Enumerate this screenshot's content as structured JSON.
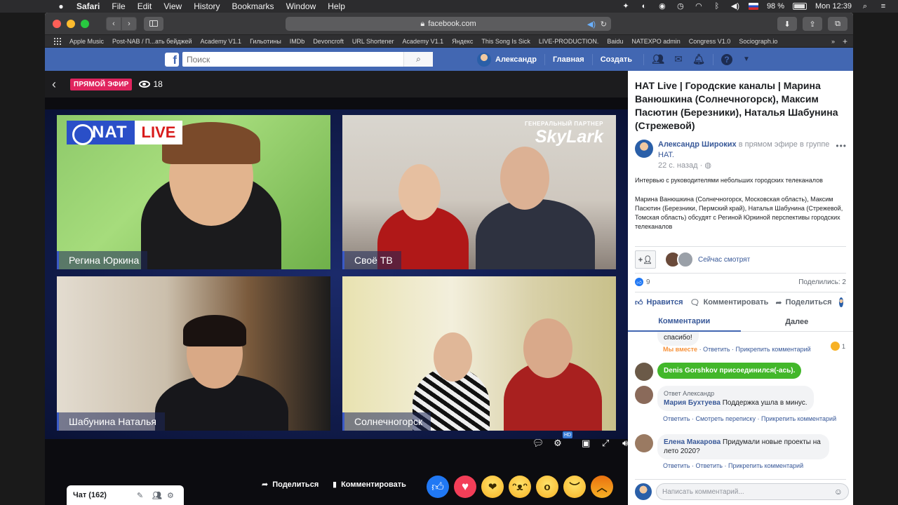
{
  "menubar": {
    "app": "Safari",
    "items": [
      "File",
      "Edit",
      "View",
      "History",
      "Bookmarks",
      "Window",
      "Help"
    ],
    "battery": "98 %",
    "clock": "Mon 12:39"
  },
  "browser": {
    "url": "facebook.com",
    "bookmarks": [
      "Apple Music",
      "Post-NAB / П...ать бейджей",
      "Academy V1.1",
      "Гильотины",
      "IMDb",
      "Devoncroft",
      "URL Shortener",
      "Academy V1.1",
      "Яндекс",
      "This Song Is Sick",
      "LIVE-PRODUCTION.",
      "Baidu",
      "NATEXPO admin",
      "Congress V1.0",
      "Sociograph.io"
    ]
  },
  "fb_header": {
    "search_placeholder": "Поиск",
    "user": "Александр",
    "home": "Главная",
    "create": "Создать"
  },
  "stage": {
    "live_label": "ПРЯМОЙ ЭФИР",
    "viewers": "18",
    "logo_text": "NAT",
    "logo_live": "LIVE",
    "partner_label": "ГЕНЕРАЛЬНЫЙ ПАРТНЕР",
    "partner_name": "SkyLark",
    "hd_label": "HD",
    "panels": [
      "Регина Юркина",
      "Своё ТВ",
      "Шабунина Наталья",
      "Солнечногорск"
    ],
    "chat_label": "Чат (162)",
    "share_label": "Поделиться",
    "comment_label": "Комментировать"
  },
  "post": {
    "title": "НАТ Live | Городские каналы | Марина Ванюшкина (Солнечногорск), Максим Пасютин (Березники), Наталья Шабунина (Стрежевой)",
    "author": "Александр Широких",
    "author_mid": "в прямом эфире в группе",
    "group": "НАТ.",
    "time": "22 с. назад ·",
    "desc1": "Интервью с руководителями небольших городских телеканалов",
    "desc2": "Марина Ванюшкина (Солнечногорск, Московская область), Максим Пасютин (Березники, Пермский край), Наталья Шабунина (Стрежевой, Томская область) обсудят с Региной Юркиной перспективы городских телеканалов",
    "watching": "Сейчас смотрят",
    "likes": "9",
    "shares": "Поделились: 2",
    "like_btn": "Нравится",
    "comment_btn": "Комментировать",
    "share_btn": "Поделиться",
    "tab_comments": "Комментарии",
    "tab_more": "Далее"
  },
  "comments": {
    "c0_text": "спасибо!",
    "c0_we": "Мы вместе",
    "c0_reply": "Ответить",
    "c0_pin": "Прикрепить комментарий",
    "c0_count": "1",
    "c1_author": "Denis Gorshkov",
    "c1_text": "присоединился(-ась).",
    "c2_reply_to": "Ответ Александр",
    "c2_author": "Мария Бухтуева",
    "c2_text": "Поддержка ушла в минус.",
    "c2_l1": "Ответить",
    "c2_l2": "Смотреть переписку",
    "c2_l3": "Прикрепить комментарий",
    "c3_author": "Елена Макарова",
    "c3_text": "Придумали новые проекты на лето 2020?",
    "c3_l1": "Ответить",
    "c3_l2": "Ответить",
    "c3_l3": "Прикрепить комментарий",
    "input_placeholder": "Написать комментарий..."
  },
  "colors": {
    "fb_blue": "#4267b2",
    "live_red": "#e0245e",
    "link_blue": "#385898",
    "join_green": "#42b72a"
  }
}
